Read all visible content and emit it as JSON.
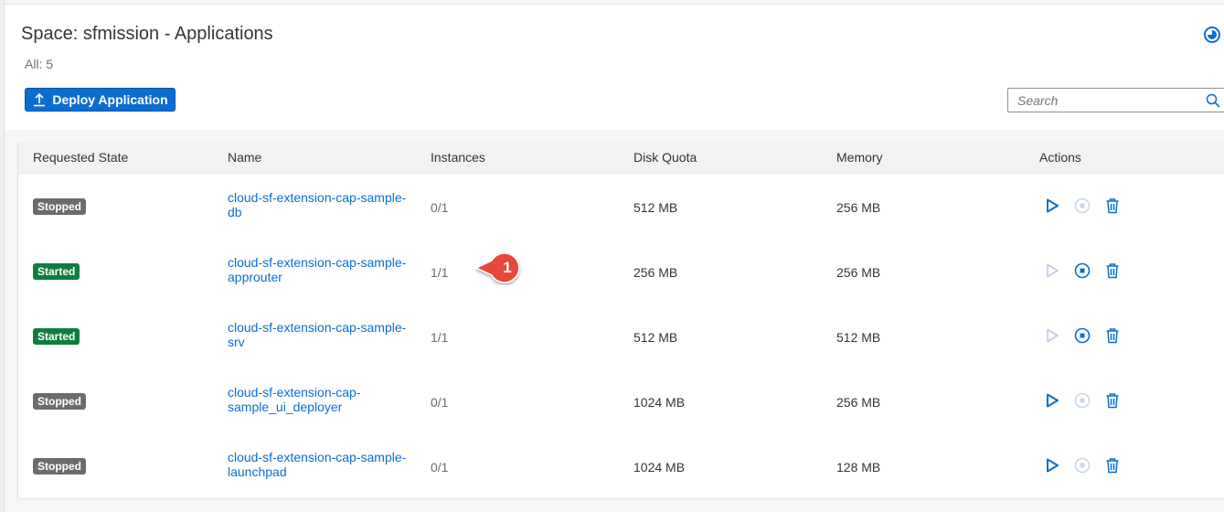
{
  "header": {
    "title": "Space: sfmission - Applications",
    "count": "All: 5",
    "deploy_label": "Deploy Application",
    "search_placeholder": "Search"
  },
  "table": {
    "columns": [
      "Requested State",
      "Name",
      "Instances",
      "Disk Quota",
      "Memory",
      "Actions"
    ],
    "rows": [
      {
        "state": "Stopped",
        "name": "cloud-sf-extension-cap-sample-db",
        "instances": "0/1",
        "disk": "512 MB",
        "memory": "256 MB"
      },
      {
        "state": "Started",
        "name": "cloud-sf-extension-cap-sample-approuter",
        "instances": "1/1",
        "disk": "256 MB",
        "memory": "256 MB"
      },
      {
        "state": "Started",
        "name": "cloud-sf-extension-cap-sample-srv",
        "instances": "1/1",
        "disk": "512 MB",
        "memory": "512 MB"
      },
      {
        "state": "Stopped",
        "name": "cloud-sf-extension-cap-sample_ui_deployer",
        "instances": "0/1",
        "disk": "1024 MB",
        "memory": "256 MB"
      },
      {
        "state": "Stopped",
        "name": "cloud-sf-extension-cap-sample-launchpad",
        "instances": "0/1",
        "disk": "1024 MB",
        "memory": "128 MB"
      }
    ]
  },
  "callout": {
    "number": "1"
  },
  "icons": {
    "deploy": "upload-icon",
    "help": "help-circle-icon",
    "search": "search-icon",
    "start": "play-icon",
    "stop": "stop-icon",
    "delete": "trash-icon"
  },
  "colors": {
    "accent": "#0a6ed1",
    "started": "#107e3e",
    "stopped": "#6a6d70",
    "callout": "#e8473a"
  }
}
